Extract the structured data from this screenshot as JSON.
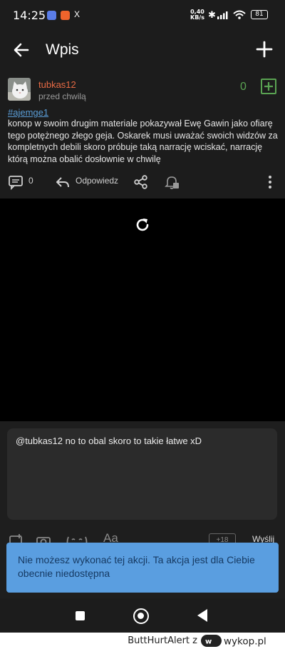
{
  "status_bar": {
    "time": "14:25",
    "app_x": "X",
    "speed_value": "0,40",
    "speed_unit": "KB/s",
    "battery": "81"
  },
  "app_bar": {
    "title": "Wpis"
  },
  "post": {
    "author": "tubkas12",
    "time": "przed chwilą",
    "votes": "0",
    "tag": "#ajemge1",
    "content": "konop w swoim drugim materiale pokazywał Ewę Gawin jako ofiarę tego potężnego złego geja. Oskarek musi uważać swoich widzów za kompletnych debili skoro próbuje taką narrację wciskać, narrację którą można obalić dosłownie w chwilę",
    "comments_count": "0",
    "reply_label": "Odpowiedz"
  },
  "reply": {
    "text": "@tubkas12 no to obal skoro to takie łatwe xD",
    "counter": "+18",
    "send_label": "Wyślij"
  },
  "snackbar": {
    "message": "Nie możesz wykonać tej akcji. Ta akcja jest dla Ciebie obecnie niedostępna"
  },
  "watermark": {
    "user": "ButtHurtAlert",
    "via": "z",
    "site": "wykop.pl"
  },
  "colors": {
    "author": "#e66a44",
    "vote": "#5aa352",
    "tag": "#5b9ed8",
    "snackbar": "#5a9ee0"
  }
}
